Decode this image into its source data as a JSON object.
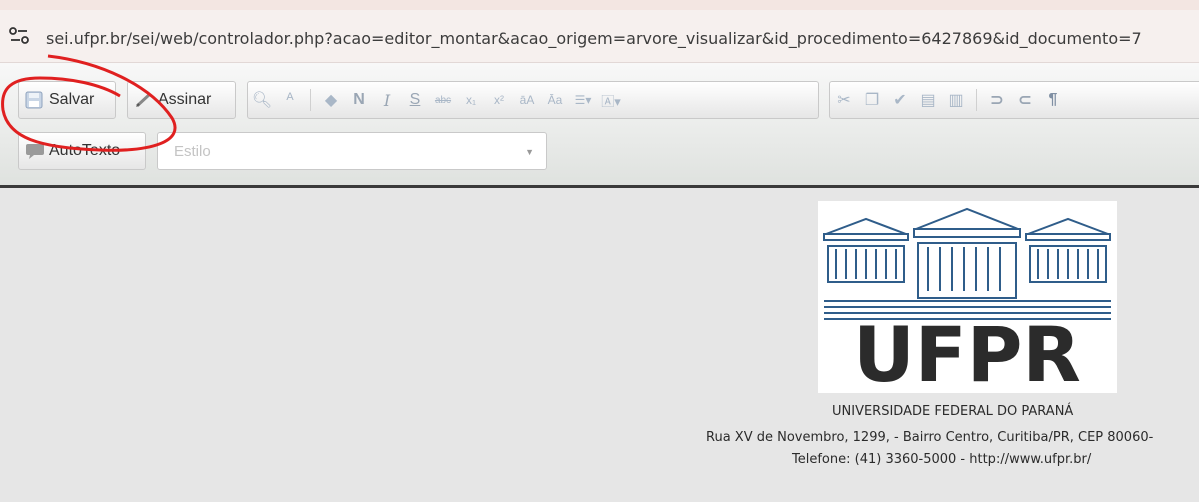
{
  "browser": {
    "url": "sei.ufpr.br/sei/web/controlador.php?acao=editor_montar&acao_origem=arvore_visualizar&id_procedimento=6427869&id_documento=7"
  },
  "toolbar": {
    "save_label": "Salvar",
    "sign_label": "Assinar",
    "autotext_label": "AutoTexto",
    "style_placeholder": "Estilo",
    "format_buttons": [
      "find-icon",
      "replace-icon",
      "eraser-icon",
      "bold-N",
      "italic-I",
      "underline-S",
      "strike",
      "subscript",
      "superscript",
      "case",
      "case",
      "paragraph",
      "color",
      "cut",
      "copy",
      "paint",
      "paste-text",
      "paste-word",
      "undo",
      "redo",
      "pilcrow"
    ],
    "bold_glyph": "N",
    "italic_glyph": "I",
    "underline_glyph": "S",
    "pilcrow_glyph": "¶"
  },
  "document": {
    "logo_text": "UFPR",
    "university_name": "UNIVERSIDADE FEDERAL DO PARANÁ",
    "address": "Rua XV de Novembro, 1299, - Bairro Centro, Curitiba/PR, CEP 80060-",
    "contact": "Telefone: (41) 3360-5000  - http://www.ufpr.br/"
  },
  "colors": {
    "annotation": "#e02020",
    "toolbar_border": "#3a3a3a",
    "icon_blue": "#a9b7c7"
  }
}
